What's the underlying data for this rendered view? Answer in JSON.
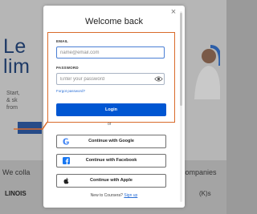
{
  "background": {
    "heading_line1": "Le",
    "heading_line2": "lim",
    "text_line1": "Start,",
    "text_line2": "& sk",
    "text_line3": "from",
    "collab_text": "We colla",
    "companies_text": "companies",
    "logo_left": "LINOIS",
    "logo_right": "(K)s"
  },
  "modal": {
    "title": "Welcome back",
    "close_glyph": "×",
    "email": {
      "label": "EMAIL",
      "placeholder": "name@email.com",
      "value": ""
    },
    "password": {
      "label": "PASSWORD",
      "placeholder": "Enter your password",
      "value": ""
    },
    "forgot_label": "Forgot password?",
    "login_label": "Login",
    "or_label": "or",
    "social": [
      {
        "label": "Continue with Google",
        "icon": "google-icon"
      },
      {
        "label": "Continue with Facebook",
        "icon": "facebook-icon"
      },
      {
        "label": "Continue with Apple",
        "icon": "apple-icon"
      }
    ],
    "signup_prompt": "New to Coursera?",
    "signup_label": "Sign up"
  },
  "colors": {
    "primary": "#0056d2",
    "highlight": "#d96b2b",
    "link": "#2a6fd6",
    "facebook": "#1877f2"
  }
}
